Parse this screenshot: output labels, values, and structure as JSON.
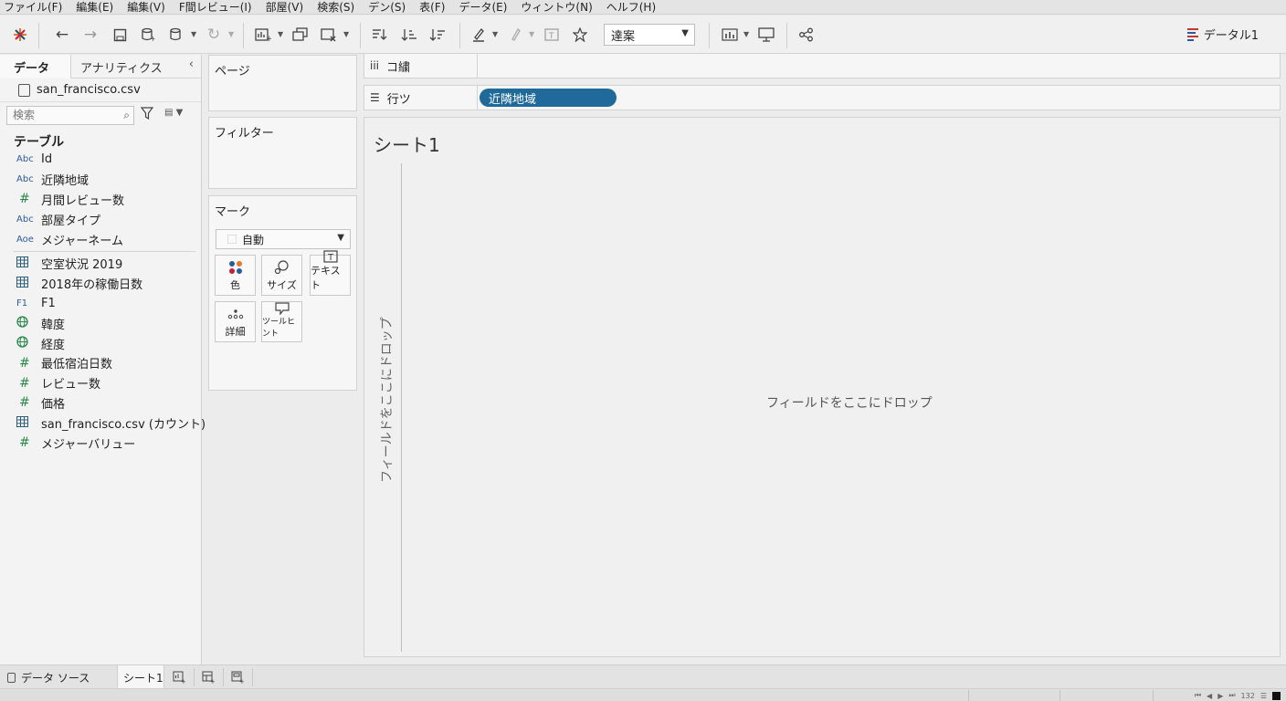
{
  "menu": [
    "ファイル(F)",
    "編集(E)",
    "編集(V)",
    "F間レビュー(I)",
    "部屋(V)",
    "検索(S)",
    "デン(S)",
    "表(F)",
    "データ(E)",
    "ウィントウ(N)",
    "ヘルフ(H)"
  ],
  "toolbar": {
    "fit_value": "達案",
    "datasource_name": "データル1",
    "icons": [
      "tableau-logo-icon",
      "undo-icon",
      "redo-icon",
      "save-icon",
      "new-datasource-icon",
      "pause-updates-icon",
      "refresh-icon",
      "new-worksheet-icon",
      "duplicate-sheet-icon",
      "clear-sheet-icon",
      "swap-rows-columns-icon",
      "sort-ascending-icon",
      "sort-descending-icon",
      "highlight-icon",
      "annotate-icon",
      "label-icon",
      "fix-axes-icon",
      "show-me-icon",
      "presentation-icon",
      "share-icon"
    ]
  },
  "data_pane": {
    "tab_data": "データ",
    "tab_analytics": "アナリティクス",
    "datasource": "san_francisco.csv",
    "search_placeholder": "検索",
    "tables_title": "テーブル",
    "dimensions": [
      {
        "type": "Abc",
        "name": "Id"
      },
      {
        "type": "Abc",
        "name": "近隣地域"
      },
      {
        "type": "#",
        "name": "月間レビュー数"
      },
      {
        "type": "Abc",
        "name": "部屋タイプ"
      },
      {
        "type": "Aoe",
        "name": "メジャーネーム"
      }
    ],
    "measures": [
      {
        "type": "table",
        "name": "空室状況 2019"
      },
      {
        "type": "table",
        "name": "2018年の稼働日数"
      },
      {
        "type": "F1",
        "name": "F1"
      },
      {
        "type": "globe",
        "name": "韓度"
      },
      {
        "type": "globe",
        "name": "経度"
      },
      {
        "type": "#",
        "name": "最低宿泊日数"
      },
      {
        "type": "#",
        "name": "レビュー数"
      },
      {
        "type": "#",
        "name": "価格"
      },
      {
        "type": "table",
        "name": "san_francisco.csv (カウント)"
      },
      {
        "type": "#",
        "name": "メジャーバリュー"
      }
    ]
  },
  "cards": {
    "pages": "ページ",
    "filters": "フィルター",
    "marks": "マーク",
    "mark_type": "自動",
    "mark_buttons": [
      "色",
      "サイズ",
      "テキスト",
      "詳細",
      "ツールヒント"
    ]
  },
  "shelves": {
    "columns_label": "コ繍",
    "rows_label": "行ツ",
    "rows_pill": "近隣地域"
  },
  "view": {
    "sheet_title": "シート1",
    "drop_vertical": "フィールドをここにドロップ",
    "drop_center": "フィールドをここにドロップ"
  },
  "tabs": {
    "datasource": "データ ソース",
    "sheet": "シート1"
  },
  "status": {
    "count": "132"
  }
}
